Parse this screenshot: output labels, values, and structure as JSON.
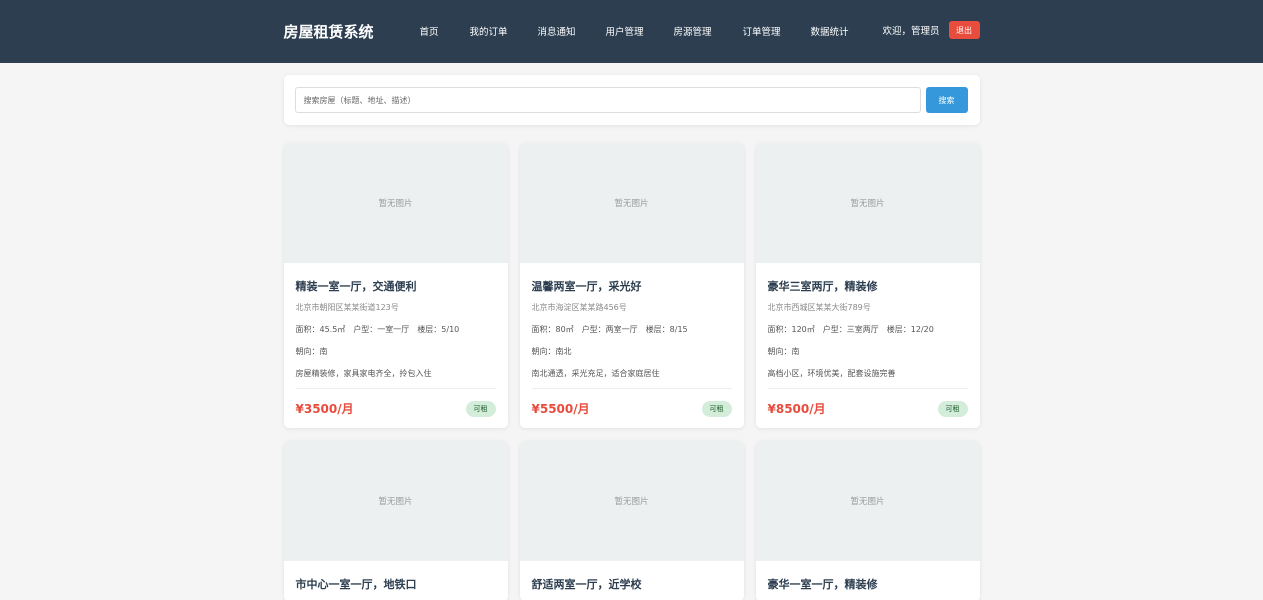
{
  "header": {
    "logo": "房屋租赁系统",
    "nav": [
      "首页",
      "我的订单",
      "消息通知",
      "用户管理",
      "房源管理",
      "订单管理",
      "数据统计"
    ],
    "welcome": "欢迎，管理员",
    "logout": "退出"
  },
  "search": {
    "placeholder": "搜索房屋（标题、地址、描述）",
    "button": "搜索"
  },
  "listings": [
    {
      "image_placeholder": "暂无图片",
      "title": "精装一室一厅，交通便利",
      "address": "北京市朝阳区某某街道123号",
      "area": "面积：45.5㎡",
      "layout": "户型：一室一厅",
      "floor": "楼层：5/10",
      "orientation": "朝向：南",
      "description": "房屋精装修，家具家电齐全，拎包入住",
      "price": "¥3500/月",
      "status": "可租"
    },
    {
      "image_placeholder": "暂无图片",
      "title": "温馨两室一厅，采光好",
      "address": "北京市海淀区某某路456号",
      "area": "面积：80㎡",
      "layout": "户型：两室一厅",
      "floor": "楼层：8/15",
      "orientation": "朝向：南北",
      "description": "南北通透，采光充足，适合家庭居住",
      "price": "¥5500/月",
      "status": "可租"
    },
    {
      "image_placeholder": "暂无图片",
      "title": "豪华三室两厅，精装修",
      "address": "北京市西城区某某大街789号",
      "area": "面积：120㎡",
      "layout": "户型：三室两厅",
      "floor": "楼层：12/20",
      "orientation": "朝向：南",
      "description": "高档小区，环境优美，配套设施完善",
      "price": "¥8500/月",
      "status": "可租"
    },
    {
      "image_placeholder": "暂无图片",
      "title": "市中心一室一厅，地铁口"
    },
    {
      "image_placeholder": "暂无图片",
      "title": "舒适两室一厅，近学校"
    },
    {
      "image_placeholder": "暂无图片",
      "title": "豪华一室一厅，精装修"
    }
  ],
  "colors": {
    "header_bg": "#2c3e50",
    "logout_bg": "#e74c3c",
    "search_button_bg": "#3498db",
    "price": "#e74c3c",
    "badge_bg": "#d4edda",
    "image_placeholder_bg": "#ecf0f1"
  }
}
